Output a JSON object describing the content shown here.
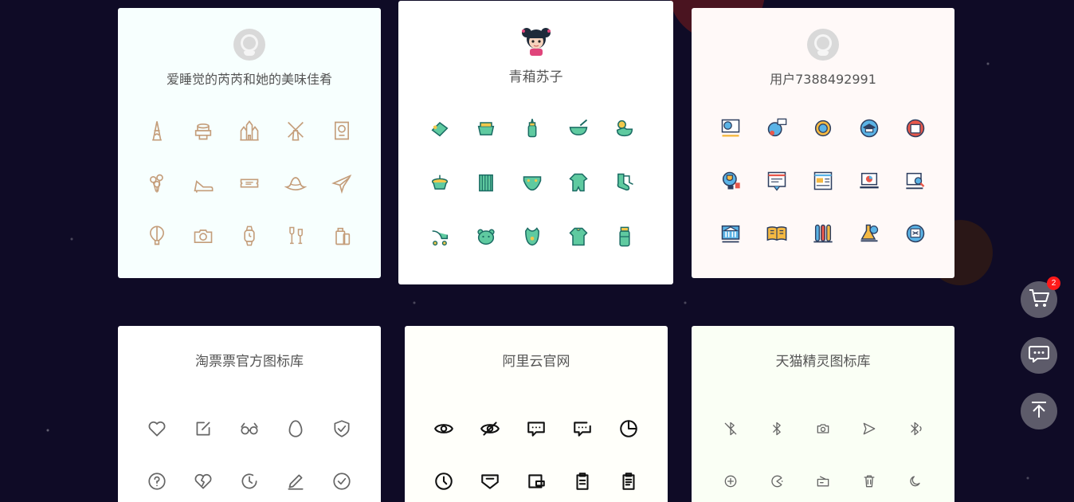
{
  "cards": [
    {
      "title": "爱睡觉的芮芮和她的美味佳肴",
      "avatar": "default-avatar",
      "bg": "#f7fffe",
      "icon_color": "#c49d7a",
      "icons": [
        "eiffel-tower-icon",
        "cake-icon",
        "castle-icon",
        "windmill-icon",
        "passport-icon",
        "balloons-icon",
        "high-heel-icon",
        "tickets-icon",
        "hat-icon",
        "airplane-icon",
        "hot-air-balloon-icon",
        "camera-icon",
        "watch-icon",
        "wine-glasses-icon",
        "luggage-icon"
      ]
    },
    {
      "title": "青葙苏子",
      "avatar": "cartoon-girl-avatar",
      "bg": "#ffffff",
      "icon_color": "#1a7a6b",
      "icons": [
        "teether-icon",
        "baby-bath-icon",
        "baby-bottle-icon",
        "baby-food-bowl-icon",
        "rubber-duck-icon",
        "potty-icon",
        "baby-bed-icon",
        "diaper-icon",
        "onesie-icon",
        "socks-icon",
        "stroller-icon",
        "baby-bear-icon",
        "bib-icon",
        "baby-shirt-icon",
        "milk-powder-icon"
      ]
    },
    {
      "title": "用户7388492991",
      "avatar": "default-avatar",
      "bg": "#fff9f8",
      "icon_color": "#3b4a6b",
      "icons": [
        "globe-board-icon",
        "abc-globe-icon",
        "planet-icon",
        "graduation-cap-icon",
        "book-icon",
        "trophy-icon",
        "online-test-icon",
        "web-page-icon",
        "laptop-chart-icon",
        "search-laptop-icon",
        "museum-icon",
        "open-book-icon",
        "test-tubes-icon",
        "lab-flask-icon",
        "classroom-screen-icon"
      ]
    },
    {
      "title": "淘票票官方图标库",
      "bg": "#ffffff",
      "icon_color": "#666666",
      "icons": [
        "heart-icon",
        "edit-icon",
        "glasses-icon",
        "egg-icon",
        "shield-check-icon",
        "question-icon",
        "broken-heart-icon",
        "clock-history-icon",
        "pencil-icon",
        "check-circle-icon"
      ]
    },
    {
      "title": "阿里云官网",
      "bg": "#fffffa",
      "icon_color": "#111111",
      "icons": [
        "eye-icon",
        "eye-off-icon",
        "message-dots-icon",
        "message-more-icon",
        "pie-chart-icon",
        "clock-icon",
        "comment-heart-icon",
        "wallet-icon",
        "clipboard-icon",
        "clipboard-list-icon"
      ]
    },
    {
      "title": "天猫精灵图标库",
      "bg": "#fafff5",
      "icon_color": "#666666",
      "icons": [
        "bluetooth-off-icon",
        "bluetooth-icon",
        "camera-icon",
        "send-icon",
        "bluetooth-signal-icon",
        "add-circle-icon",
        "pacman-icon",
        "radio-icon",
        "trash-icon",
        "moon-icon"
      ]
    }
  ],
  "side_buttons": {
    "cart_badge": "2",
    "cart": "cart-icon",
    "chat": "chat-icon",
    "top": "back-to-top-icon"
  }
}
